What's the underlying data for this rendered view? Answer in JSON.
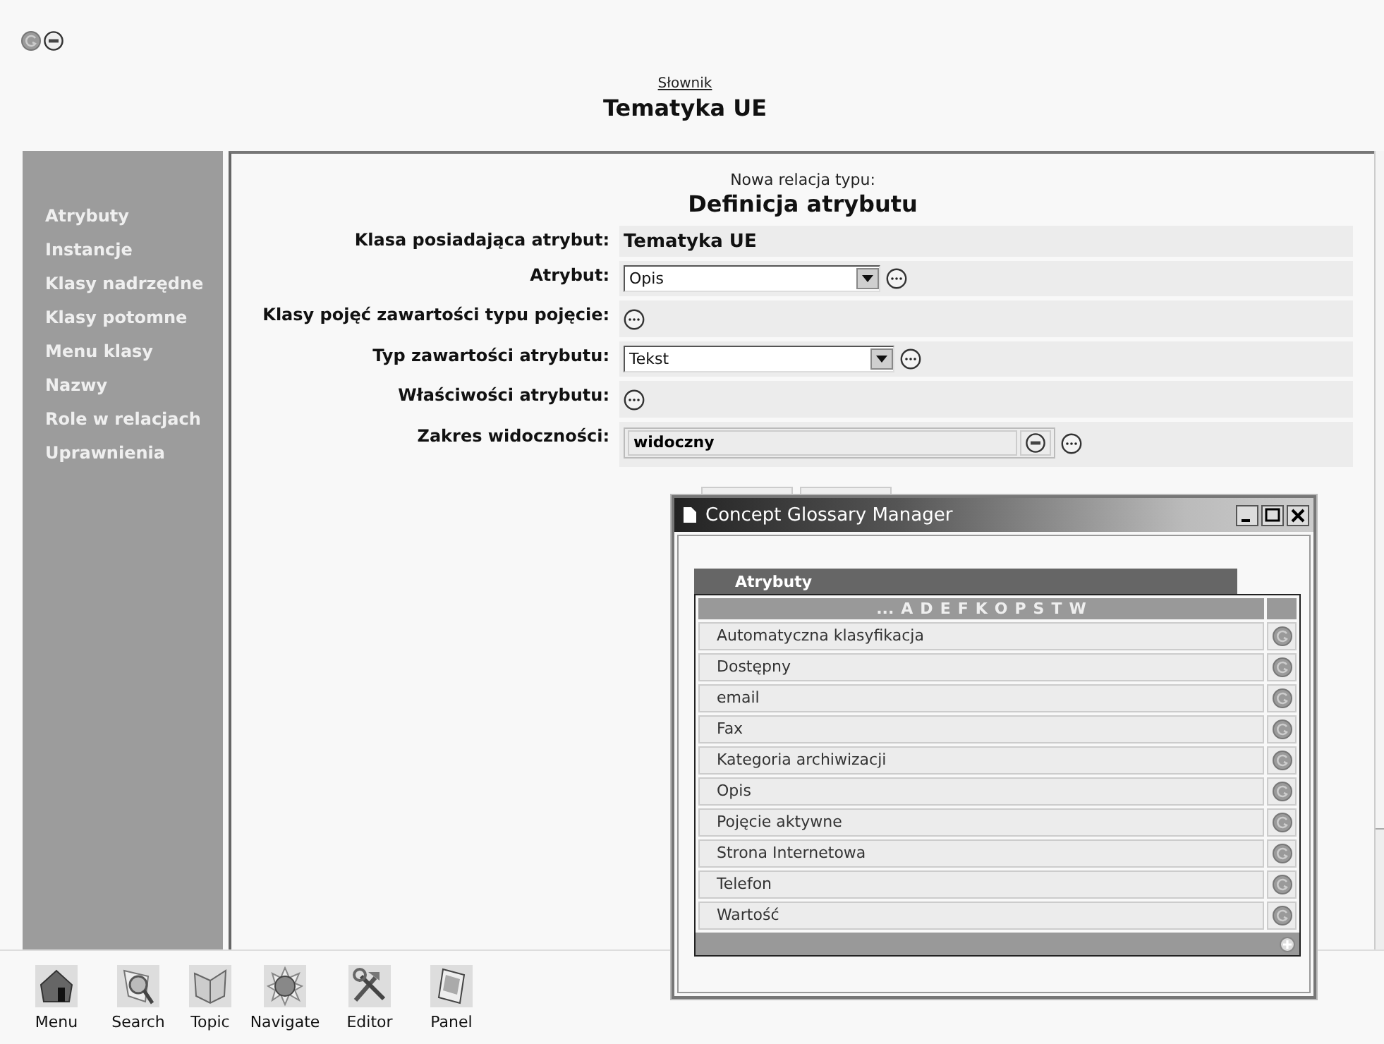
{
  "header": {
    "breadcrumb": "Słownik",
    "title": "Tematyka UE"
  },
  "sidebar": {
    "items": [
      "Atrybuty",
      "Instancje",
      "Klasy nadrzędne",
      "Klasy potomne",
      "Menu klasy",
      "Nazwy",
      "Role w relacjach",
      "Uprawnienia"
    ]
  },
  "form": {
    "subtitle": "Nowa relacja typu:",
    "title": "Definicja atrybutu",
    "rows": [
      {
        "label": "Klasa posiadająca atrybut:",
        "kind": "text",
        "value": "Tematyka UE"
      },
      {
        "label": "Atrybut:",
        "kind": "select",
        "value": "Opis"
      },
      {
        "label": "Klasy pojęć zawartości typu pojęcie:",
        "kind": "more"
      },
      {
        "label": "Typ zawartości atrybutu:",
        "kind": "select",
        "value": "Tekst"
      },
      {
        "label": "Właściwości atrybutu:",
        "kind": "more"
      },
      {
        "label": "Zakres widoczności:",
        "kind": "list",
        "value": "widoczny"
      }
    ]
  },
  "dialog": {
    "title": "Concept Glossary Manager",
    "tab": "Atrybuty",
    "alphabet": [
      "...",
      "A",
      "D",
      "E",
      "F",
      "K",
      "O",
      "P",
      "S",
      "T",
      "W"
    ],
    "items": [
      "Automatyczna klasyfikacja",
      "Dostępny",
      "email",
      "Fax",
      "Kategoria archiwizacji",
      "Opis",
      "Pojęcie aktywne",
      "Strona Internetowa",
      "Telefon",
      "Wartość"
    ]
  },
  "toolbar": [
    {
      "label": "Menu",
      "kind": "house"
    },
    {
      "label": "Search",
      "kind": "search"
    },
    {
      "label": "Topic",
      "kind": "book"
    },
    {
      "label": "Navigate",
      "kind": "globe"
    },
    {
      "label": "Editor",
      "kind": "tools"
    },
    {
      "label": "Panel",
      "kind": "tablet"
    }
  ]
}
